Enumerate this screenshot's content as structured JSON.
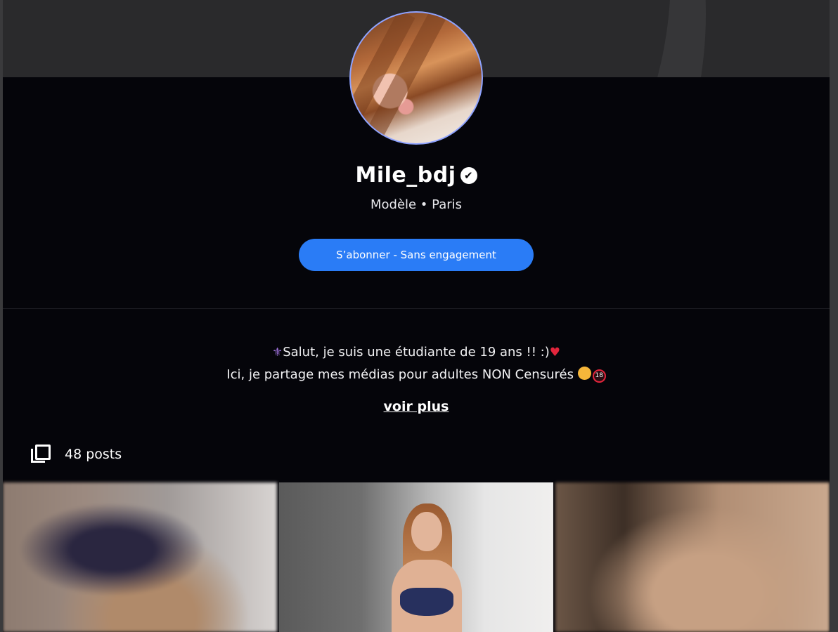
{
  "profile": {
    "name": "Mile_bdj",
    "subtitle": "Modèle • Paris"
  },
  "actions": {
    "subscribe_label": "S’abonner - Sans engagement",
    "see_more_label": "voir plus"
  },
  "bio": {
    "line1": "Salut, je suis une étudiante de 19 ans !! :)",
    "line2": "Ici, je partage mes médias pour adultes NON Censurés",
    "badge": "18"
  },
  "posts": {
    "count_label": "48 posts"
  },
  "icons": {
    "verified": "verified-check-icon",
    "posts": "gallery-icon"
  },
  "colors": {
    "accent": "#2a7cf6",
    "background": "#05050a",
    "heart": "#e3253c"
  }
}
